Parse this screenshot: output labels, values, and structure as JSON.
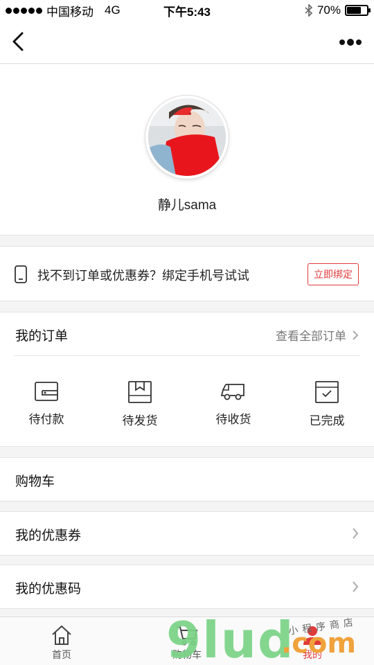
{
  "status_bar": {
    "carrier": "中国移动",
    "network": "4G",
    "time": "下午5:43",
    "battery_percent": "70%",
    "battery_level": 0.7
  },
  "profile": {
    "username": "静儿sama"
  },
  "bind_phone": {
    "message": "找不到订单或优惠券？绑定手机号试试",
    "button_label": "立即绑定"
  },
  "orders": {
    "title": "我的订单",
    "view_all": "查看全部订单",
    "items": [
      {
        "label": "待付款",
        "icon": "wallet-icon"
      },
      {
        "label": "待发货",
        "icon": "package-icon"
      },
      {
        "label": "待收货",
        "icon": "truck-icon"
      },
      {
        "label": "已完成",
        "icon": "checked-box-icon"
      }
    ]
  },
  "menu": {
    "cart": "购物车",
    "coupons": "我的优惠券",
    "promo_codes": "我的优惠码"
  },
  "tabbar": {
    "tabs": [
      {
        "label": "首页",
        "icon": "home-icon"
      },
      {
        "label": "购物车",
        "icon": "cart-icon"
      },
      {
        "label": "我的",
        "icon": "user-icon"
      }
    ]
  },
  "watermark": {
    "brand": "9lud",
    "domain": ".com",
    "tagline": "小程序商店"
  },
  "colors": {
    "accent": "#e03a3a",
    "watermark_green": "#7bd487",
    "watermark_orange": "#f0a23b"
  }
}
